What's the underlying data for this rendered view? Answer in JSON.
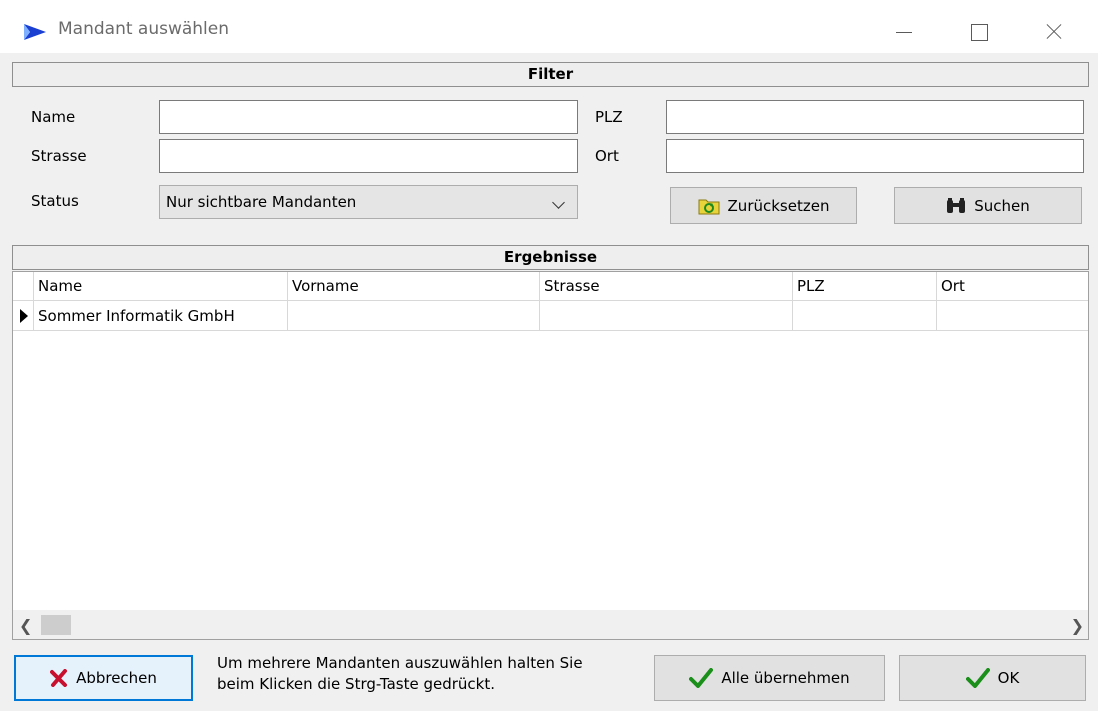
{
  "window": {
    "title": "Mandant auswählen",
    "accent_color": "#0078d7"
  },
  "filter": {
    "header": "Filter",
    "name_label": "Name",
    "name_value": "",
    "plz_label": "PLZ",
    "plz_value": "",
    "strasse_label": "Strasse",
    "strasse_value": "",
    "ort_label": "Ort",
    "ort_value": "",
    "status_label": "Status",
    "status_selected": "Nur sichtbare Mandanten",
    "reset_button": "Zurücksetzen",
    "search_button": "Suchen"
  },
  "results": {
    "header": "Ergebnisse",
    "columns": [
      "Name",
      "Vorname",
      "Strasse",
      "PLZ",
      "Ort"
    ],
    "rows": [
      [
        "Sommer Informatik GmbH",
        "",
        "",
        "",
        ""
      ]
    ]
  },
  "footer": {
    "cancel_button": "Abbrechen",
    "hint_line1": "Um mehrere Mandanten auszuwählen halten Sie",
    "hint_line2": "beim Klicken die Strg-Taste gedrückt.",
    "take_all_button": "Alle übernehmen",
    "ok_button": "OK"
  },
  "icons": {
    "app": "play-arrow-icon",
    "reset": "folder-refresh-icon",
    "search": "binoculars-icon",
    "cancel": "red-x-icon",
    "confirm": "green-check-icon"
  }
}
